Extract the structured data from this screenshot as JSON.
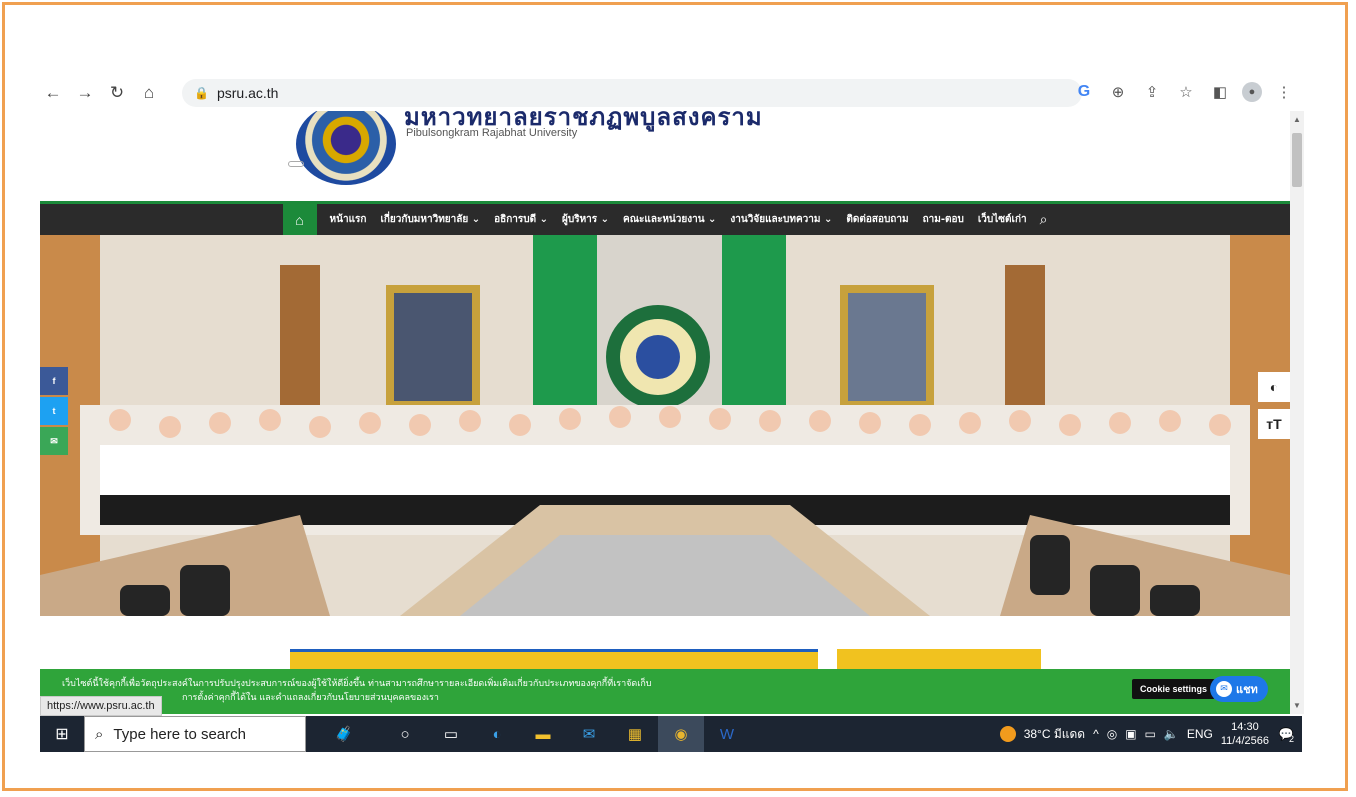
{
  "browser": {
    "url": "psru.ac.th",
    "status_url": "https://www.psru.ac.th"
  },
  "site": {
    "name_en": "Pibulsongkram Rajabhat University",
    "name_th_partial": "มหาวิทยาลัยราชภัฏพิบูลสงคราม"
  },
  "nav": {
    "items": [
      "หน้าแรก",
      "เกี่ยวกับมหาวิทยาลัย ⌄",
      "อธิการบดี ⌄",
      "ผู้บริหาร ⌄",
      "คณะและหน่วยงาน ⌄",
      "งานวิจัยและบทความ ⌄",
      "ติดต่อสอบถาม",
      "ถาม-ตอบ",
      "เว็บไซต์เก่า"
    ]
  },
  "social": {
    "facebook": "f",
    "twitter": "t",
    "email": "✉"
  },
  "access": {
    "contrast": "◐",
    "textsize": "тT"
  },
  "cookie": {
    "line1": "เว็บไซต์นี้ใช้คุกกี้เพื่อวัตถุประสงค์ในการปรับปรุงประสบการณ์ของผู้ใช้ให้ดียิ่งขึ้น ท่านสามารถศึกษารายละเอียดเพิ่มเติมเกี่ยวกับประเภทของคุกกี้ที่เราจัดเก็บ",
    "line2": "การตั้งค่าคุกกี้ได้ใน และคำแถลงเกี่ยวกับนโยบายส่วนบุคคลของเรา",
    "settings_label": "Cookie settings",
    "chat_label": "แชท"
  },
  "taskbar": {
    "search_placeholder": "Type here to search",
    "weather": "38°C มีแดด",
    "language": "ENG",
    "time": "14:30",
    "date": "11/4/2566",
    "notification_count": "2"
  },
  "colors": {
    "nav_bg": "#2b2b2b",
    "brand_green": "#1c8a3a",
    "cookie_green": "#2fa43a",
    "chat_blue": "#1e78e8",
    "taskbar_bg": "#1c2532"
  }
}
